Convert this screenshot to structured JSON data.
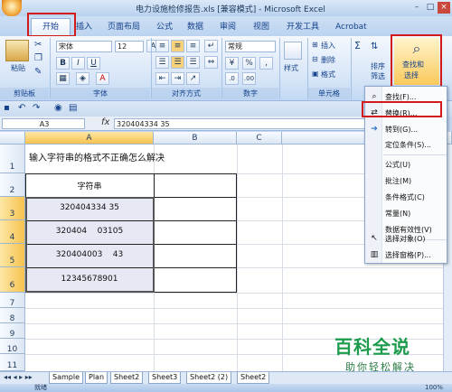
{
  "window": {
    "title": "电力设施检修报告.xls [兼容模式] - Microsoft Excel",
    "min": "–",
    "max": "□",
    "close": "×"
  },
  "tabs": [
    "开始",
    "插入",
    "页面布局",
    "公式",
    "数据",
    "审阅",
    "视图",
    "开发工具",
    "Acrobat"
  ],
  "ribbon": {
    "paste": "粘贴",
    "font_name": "宋体",
    "font_size": "12",
    "bold": "B",
    "italic": "I",
    "underline": "U",
    "number_format": "常规",
    "percent": "%",
    "comma": ",",
    "style": "样式",
    "insert": "插入",
    "delete": "删除",
    "format": "格式",
    "sort_filter": "排序和\n筛选",
    "sort_line1": "排序",
    "sort_line2": "筛选",
    "find_select_line1": "查找和",
    "find_select_line2": "选择",
    "sigma": "Σ",
    "groups": [
      "剪贴板",
      "字体",
      "对齐方式",
      "数字",
      "单元格"
    ]
  },
  "formula_bar": {
    "name_box": "A3",
    "fx": "fx",
    "content": "320404334 35"
  },
  "grid": {
    "columns": [
      "A",
      "B",
      "C"
    ],
    "rows": [
      "1",
      "2",
      "3",
      "4",
      "5",
      "6",
      "7",
      "8",
      "9",
      "10",
      "11"
    ],
    "title": "输入字符串的格式不正确怎么解决",
    "header": "字符串",
    "values": [
      "320404334 35",
      "320404    03105",
      "320404003    43",
      "12345678901"
    ]
  },
  "menu": {
    "items": [
      {
        "label": "查找(F)...",
        "icon": "find-icon"
      },
      {
        "label": "替换(R)...",
        "icon": "replace-icon"
      },
      {
        "label": "转到(G)...",
        "icon": "goto-arrow-icon"
      },
      {
        "label": "定位条件(S)...",
        "icon": ""
      },
      {
        "label": "公式(U)",
        "icon": ""
      },
      {
        "label": "批注(M)",
        "icon": ""
      },
      {
        "label": "条件格式(C)",
        "icon": ""
      },
      {
        "label": "常量(N)",
        "icon": ""
      },
      {
        "label": "数据有效性(V)",
        "icon": ""
      },
      {
        "label": "选择对象(O)",
        "icon": "select-objects-icon"
      },
      {
        "label": "选择窗格(P)...",
        "icon": "selection-pane-icon"
      }
    ]
  },
  "sheets": [
    "Sample",
    "Plan",
    "Sheet2",
    "Sheet3",
    "Sheet2 (2)",
    "Sheet2"
  ],
  "status": {
    "ready": "就绪",
    "zoom": "100%"
  },
  "watermark": {
    "line1": "百科全说",
    "line2": "助你轻松解决"
  },
  "colors": {
    "highlight": "#d21a1a",
    "ribbon": "#d5e4f7",
    "cell_fill": "#e6e9f4"
  }
}
